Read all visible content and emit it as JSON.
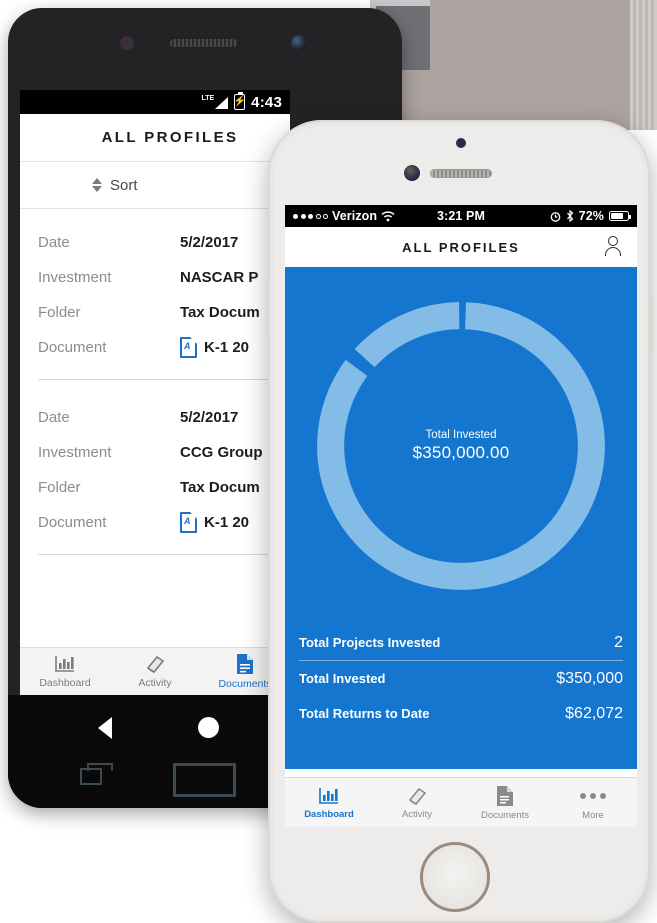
{
  "android": {
    "status_bar": {
      "network": "LTE",
      "time": "4:43",
      "battery_icon": "battery-charging-icon"
    },
    "nav_title": "ALL PROFILES",
    "sort_label": "Sort",
    "records": [
      {
        "date_label": "Date",
        "date_value": "5/2/2017",
        "investment_label": "Investment",
        "investment_value": "NASCAR P",
        "folder_label": "Folder",
        "folder_value": "Tax Docum",
        "document_label": "Document",
        "document_value": "K-1 20"
      },
      {
        "date_label": "Date",
        "date_value": "5/2/2017",
        "investment_label": "Investment",
        "investment_value": "CCG Group",
        "folder_label": "Folder",
        "folder_value": "Tax Docum",
        "document_label": "Document",
        "document_value": "K-1 20"
      }
    ],
    "tabs": [
      {
        "label": "Dashboard",
        "icon": "bar-chart-icon",
        "active": false
      },
      {
        "label": "Activity",
        "icon": "book-icon",
        "active": false
      },
      {
        "label": "Documents",
        "icon": "document-icon",
        "active": true
      }
    ],
    "nav_buttons": [
      "back-button",
      "home-button",
      "recents-button",
      "rect-button"
    ]
  },
  "iphone": {
    "status_bar": {
      "carrier": "Verizon",
      "signal_dots": "●●●○○",
      "wifi_icon": "wifi-icon",
      "time": "3:21 PM",
      "alarm_icon": "alarm-icon",
      "bluetooth_icon": "bluetooth-icon",
      "battery_percent": "72%"
    },
    "nav_title": "ALL PROFILES",
    "profile_icon": "person-icon",
    "donut": {
      "center_label": "Total Invested",
      "center_value": "$350,000.00"
    },
    "stats": [
      {
        "label": "Total Projects Invested",
        "value": "2"
      },
      {
        "label": "Total Invested",
        "value": "$350,000"
      },
      {
        "label": "Total Returns to Date",
        "value": "$62,072"
      }
    ],
    "tabs": [
      {
        "label": "Dashboard",
        "icon": "bar-chart-icon",
        "active": true
      },
      {
        "label": "Activity",
        "icon": "book-icon",
        "active": false
      },
      {
        "label": "Documents",
        "icon": "document-icon",
        "active": false
      },
      {
        "label": "More",
        "icon": "ellipsis-icon",
        "active": false
      }
    ]
  },
  "chart_data": {
    "type": "pie",
    "title": "Total Invested",
    "center_label": "Total Invested",
    "center_value": "$350,000.00",
    "categories": [
      "NASCAR P",
      "CCG Group"
    ],
    "values": [
      300000,
      50000
    ],
    "percentages": [
      85.7,
      14.3
    ],
    "colors": [
      "#84bce8",
      "#84bce8"
    ],
    "background_color": "#1476ce",
    "donut": true,
    "inner_radius_ratio": 0.78,
    "legend": "none",
    "grid": false
  },
  "colors": {
    "brand_blue": "#1476ce",
    "ring_light_blue": "#84bce8",
    "android_accent": "#1a73c8",
    "backdrop_grey": "#ada3a1"
  }
}
